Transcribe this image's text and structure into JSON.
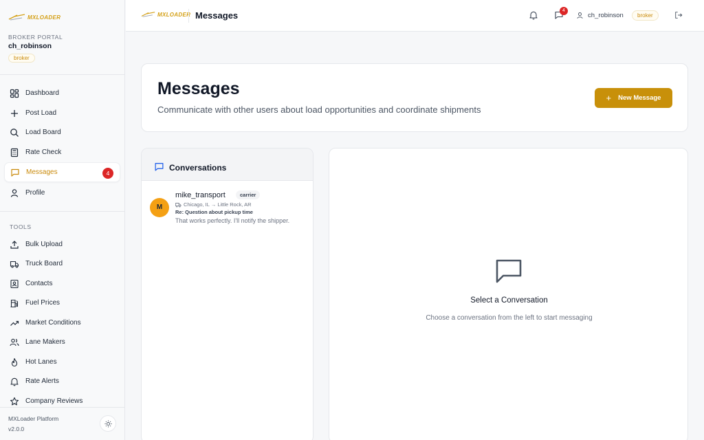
{
  "app": {
    "logo_text": "MXLOADER",
    "page_title": "Messages"
  },
  "sidebar": {
    "portal_label": "BROKER PORTAL",
    "username": "ch_robinson",
    "role": "broker",
    "nav": [
      {
        "label": "Dashboard",
        "icon": "dashboard-icon"
      },
      {
        "label": "Post Load",
        "icon": "plus-icon"
      },
      {
        "label": "Load Board",
        "icon": "search-icon"
      },
      {
        "label": "Rate Check",
        "icon": "calculator-icon"
      },
      {
        "label": "Messages",
        "icon": "message-icon",
        "active": true,
        "badge": "4"
      },
      {
        "label": "Profile",
        "icon": "user-icon"
      }
    ],
    "tools_label": "TOOLS",
    "tools": [
      {
        "label": "Bulk Upload",
        "icon": "upload-icon"
      },
      {
        "label": "Truck Board",
        "icon": "truck-icon"
      },
      {
        "label": "Contacts",
        "icon": "contacts-icon"
      },
      {
        "label": "Fuel Prices",
        "icon": "fuel-icon"
      },
      {
        "label": "Market Conditions",
        "icon": "trending-icon"
      },
      {
        "label": "Lane Makers",
        "icon": "users-icon"
      },
      {
        "label": "Hot Lanes",
        "icon": "flame-icon"
      },
      {
        "label": "Rate Alerts",
        "icon": "bell-icon"
      },
      {
        "label": "Company Reviews",
        "icon": "star-icon"
      }
    ],
    "platform": "MXLoader Platform",
    "version": "v2.0.0"
  },
  "topbar": {
    "title": "Messages",
    "message_badge": "4",
    "username": "ch_robinson",
    "role": "broker"
  },
  "header": {
    "title": "Messages",
    "subtitle": "Communicate with other users about load opportunities and coordinate shipments",
    "new_button": "New Message"
  },
  "conversations": {
    "title": "Conversations",
    "items": [
      {
        "avatar": "M",
        "name": "mike_transport",
        "role": "carrier",
        "route": "Chicago, IL → Little Rock, AR",
        "subject": "Re: Question about pickup time",
        "preview": "That works perfectly. I'll notify the shipper."
      }
    ]
  },
  "empty_state": {
    "title": "Select a Conversation",
    "subtitle": "Choose a conversation from the left to start messaging"
  },
  "colors": {
    "accent": "#c8900a",
    "badge": "#dc2626",
    "avatar": "#f4a014"
  }
}
